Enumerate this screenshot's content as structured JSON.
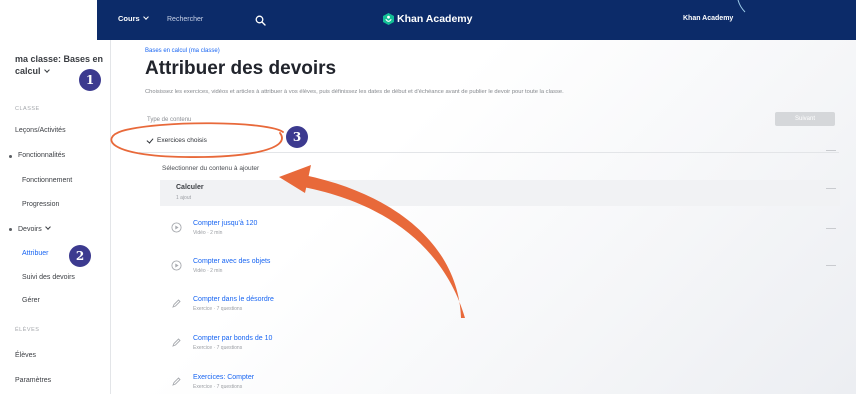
{
  "colors": {
    "nav_bg": "#0c2b69",
    "accent": "#1865f2",
    "badge": "#3c3a8f",
    "annotation": "#e8693a",
    "logo_green": "#14bf96"
  },
  "nav": {
    "courses_label": "Cours",
    "courses_icon": "chevron-down-icon",
    "search_placeholder": "Rechercher",
    "search_icon": "search-icon",
    "logo_icon": "khan-academy-leaf-icon",
    "logo_text": "Khan Academy",
    "account_label": "Khan Academy"
  },
  "sidebar": {
    "class_selector": "ma classe: Bases en calcul",
    "class_selector_icon": "chevron-down-icon",
    "class_section_header": "Classe",
    "activity_link": "Leçons/Activités",
    "reports_group": {
      "label": "Fonctionnalités",
      "items": [
        "Fonctionnement",
        "Progression"
      ]
    },
    "assignments_group": {
      "label": "Devoirs",
      "items": [
        "Attribuer",
        "Suivi des devoirs",
        "Gérer"
      ],
      "selected_index": 0
    },
    "students_section_header": "Élèves",
    "students_link": "Élèves",
    "settings_link": "Paramètres"
  },
  "main": {
    "breadcrumb": "Bases en calcul (ma classe)",
    "title": "Attribuer des devoirs",
    "subtitle": "Choisissez les exercices, vidéos et articles à attribuer à vos élèves, puis définissez les dates de début et d'échéance avant de publier le devoir pour toute la classe.",
    "next_button": "Suivant",
    "content_type_label": "Type de contenu",
    "content_type_selected": "Exercices choisis",
    "select_prompt": "Sélectionner du contenu à ajouter",
    "unit": {
      "title": "Calculer",
      "meta": "1 ajout"
    },
    "items": [
      {
        "title": "Compter jusqu'à 120",
        "meta": "Vidéo · 2 min",
        "icon": "video-icon"
      },
      {
        "title": "Compter avec des objets",
        "meta": "Vidéo · 2 min",
        "icon": "video-icon"
      },
      {
        "title": "Compter dans le désordre",
        "meta": "Exercice · 7 questions",
        "icon": "exercise-icon"
      },
      {
        "title": "Compter par bonds de 10",
        "meta": "Exercice · 7 questions",
        "icon": "exercise-icon"
      },
      {
        "title": "Exercices: Compter",
        "meta": "Exercice · 7 questions",
        "icon": "exercise-icon"
      }
    ]
  },
  "annotations": {
    "badges": [
      "1",
      "2",
      "3"
    ],
    "shapes": [
      "orange-ellipse",
      "orange-curved-arrow"
    ]
  }
}
